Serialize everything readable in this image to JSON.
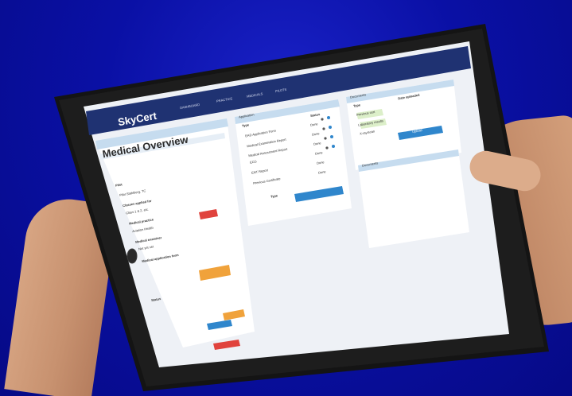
{
  "app": {
    "brand": "SkyCert"
  },
  "nav": {
    "items": [
      "DASHBOARD",
      "PRACTICE",
      "MEDICALS",
      "PILOTS"
    ]
  },
  "left_panel": {
    "title": "Medical Overview",
    "lines": [
      "Pilot",
      "Pilot Stahlberg, TC",
      "Classes applied for",
      "Class 1 & 2, etc.",
      "Medical practice",
      "Aviation Health",
      "Medical examiner",
      "Not yet set",
      "Medical application form",
      "Status"
    ]
  },
  "middle_panel": {
    "header": "Application",
    "col_type": "Type",
    "col_status": "Status",
    "rows": [
      {
        "label": "EAD Application Form",
        "status": "Done"
      },
      {
        "label": "Medical Examination Report",
        "status": "Done"
      },
      {
        "label": "Medical Assessment Report",
        "status": "Done"
      },
      {
        "label": "ECG",
        "status": "Done"
      },
      {
        "label": "ENT Report",
        "status": "Done"
      },
      {
        "label": "Previous Certificate",
        "status": "Done"
      }
    ],
    "button": "Type"
  },
  "right_panel": {
    "header": "Documents",
    "col_type": "Type",
    "col_date": "Date uploaded",
    "rows": [
      "Previous cert",
      "Laboratory results",
      "X-ray/scan"
    ],
    "button": "Upload"
  },
  "right_panel2": {
    "header": "Documents"
  },
  "colors": {
    "background": "#0a10a5",
    "tablet_frame": "#151515",
    "brand_bar": "#1f3272",
    "panel_header": "#c6dcef",
    "button_blue": "#2f86cc",
    "button_red": "#e0433d",
    "button_orange": "#f0a23b",
    "row_green": "#dcefc9"
  }
}
